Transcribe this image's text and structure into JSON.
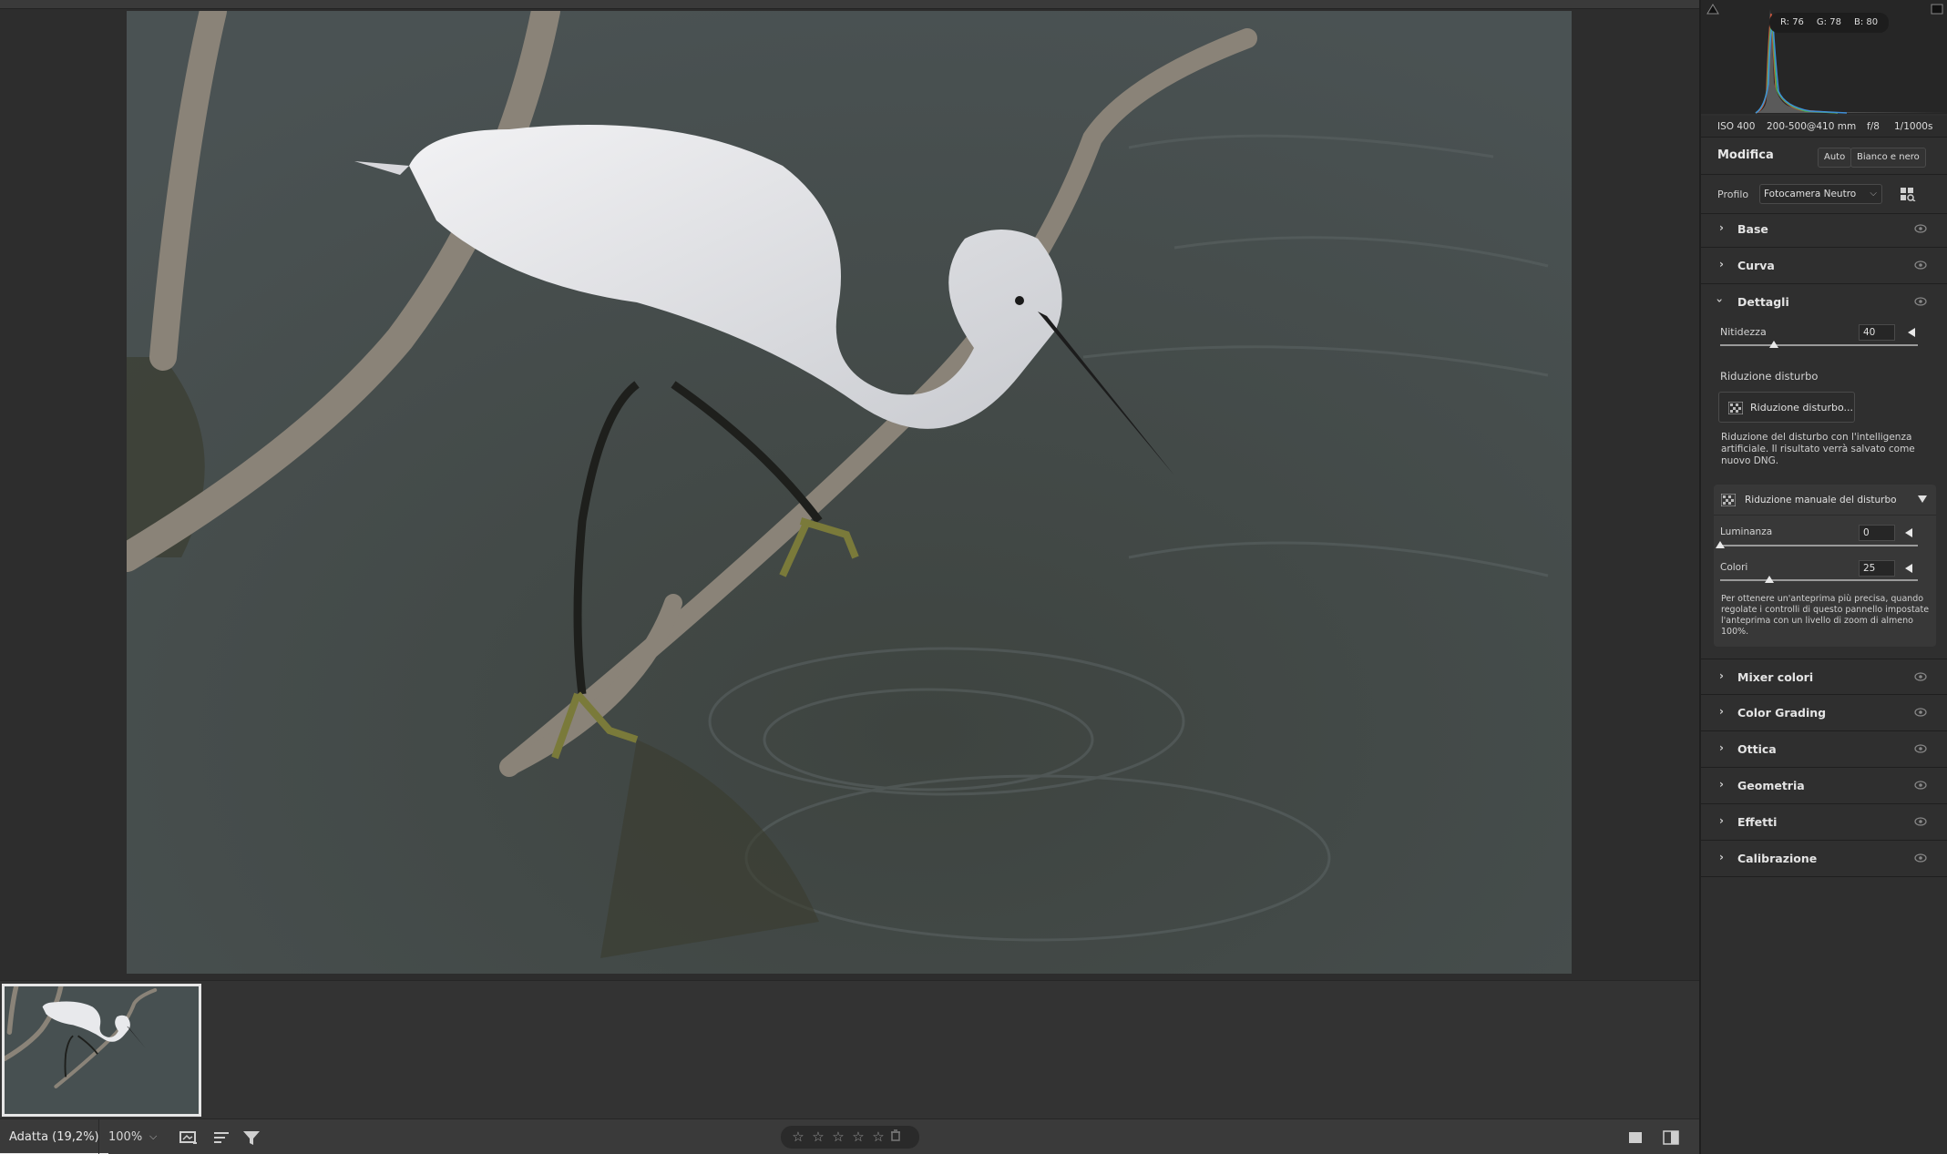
{
  "photo": {
    "alt": "egret-on-branch"
  },
  "bottombar": {
    "zoom_fit": "Adatta (19,2%)",
    "zoom_percent": "100%",
    "stars": [
      "☆",
      "☆",
      "☆",
      "☆",
      "☆"
    ],
    "filter_icon": "filter-icon",
    "sort_icon": "sort-icon",
    "filmstrip_icon": "filmstrip-icon",
    "single_view_icon": "single-view-icon",
    "compare_view_icon": "compare-view-icon"
  },
  "histogram": {
    "readout": {
      "r": "R: 76",
      "g": "G: 78",
      "b": "B: 80"
    }
  },
  "exif": {
    "iso": "ISO 400",
    "lens": "200-500@410 mm",
    "aperture": "f/8",
    "shutter": "1/1000s"
  },
  "edit": {
    "title": "Modifica",
    "auto_btn": "Auto",
    "bw_btn": "Bianco e nero",
    "profile_label": "Profilo",
    "profile_value": "Fotocamera Neutro"
  },
  "sections_top": [
    {
      "label": "Base"
    },
    {
      "label": "Curva"
    }
  ],
  "details": {
    "title": "Dettagli",
    "sharpness_label": "Nitidezza",
    "sharpness_value": "40",
    "sharpness_fraction": 0.27,
    "noise_title": "Riduzione disturbo",
    "noise_button": "Riduzione disturbo...",
    "noise_desc": "Riduzione del disturbo con l'intelligenza artificiale. Il risultato verrà salvato come nuovo DNG.",
    "manual_title": "Riduzione manuale del disturbo",
    "luminance_label": "Luminanza",
    "luminance_value": "0",
    "luminance_fraction": 0.0,
    "color_label": "Colori",
    "color_value": "25",
    "color_fraction": 0.25,
    "manual_note": "Per ottenere un'anteprima più precisa, quando regolate i controlli di questo pannello impostate l'anteprima con un livello di zoom di almeno 100%."
  },
  "sections_bottom": [
    {
      "label": "Mixer colori"
    },
    {
      "label": "Color Grading"
    },
    {
      "label": "Ottica"
    },
    {
      "label": "Geometria"
    },
    {
      "label": "Effetti"
    },
    {
      "label": "Calibrazione"
    }
  ],
  "colors": {
    "panel_bg": "#2f2f2f",
    "canvas_bg": "#2d2d2d",
    "accent_white": "#e8e8e8"
  }
}
